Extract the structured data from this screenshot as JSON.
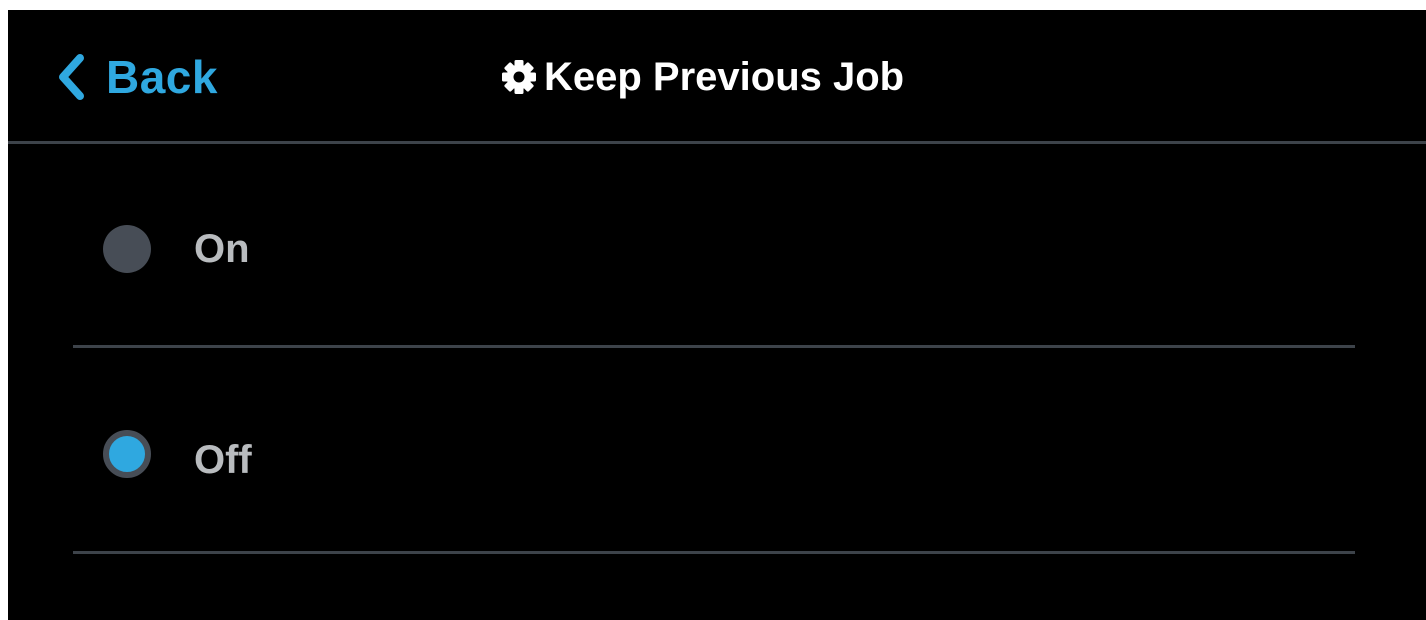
{
  "header": {
    "back_label": "Back",
    "title": "Keep Previous Job",
    "back_icon": "chevron-left-icon",
    "title_icon": "gear-icon"
  },
  "options": [
    {
      "label": "On",
      "selected": false
    },
    {
      "label": "Off",
      "selected": true
    }
  ],
  "colors": {
    "background": "#000000",
    "accent": "#2fa8e0",
    "divider": "#3d434a",
    "radio_inactive": "#474d56",
    "option_text": "#b9bcbf",
    "title_text": "#ffffff"
  }
}
